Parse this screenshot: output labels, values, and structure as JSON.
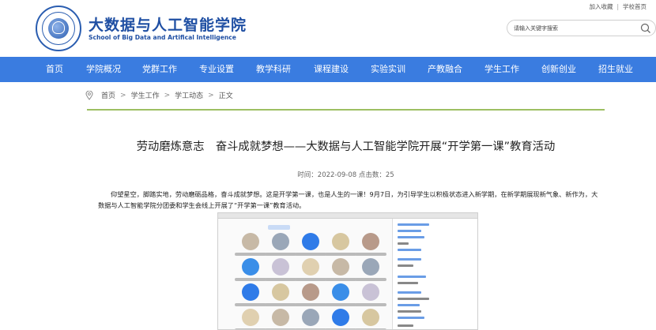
{
  "header": {
    "links": [
      "加入收藏",
      "学校首页"
    ],
    "logo_cn": "大数据与人工智能学院",
    "logo_en": "School of Big Data and Artifical Intelligence",
    "search_placeholder": "请输入关键字搜索"
  },
  "nav": {
    "items": [
      "首页",
      "学院概况",
      "党群工作",
      "专业设置",
      "教学科研",
      "课程建设",
      "实验实训",
      "产教融合",
      "学生工作",
      "创新创业",
      "招生就业"
    ]
  },
  "breadcrumb": [
    "首页",
    "学生工作",
    "学工动态",
    "正文"
  ],
  "article": {
    "title": "劳动磨炼意志　奋斗成就梦想——大数据与人工智能学院开展“开学第一课”教育活动",
    "meta": "时间：2022-09-08 点击数：25",
    "paragraph": "仰望星空，脚踏实地，劳动磨砺品格，奋斗成就梦想。这是开学第一课，也是人生的一课！9月7日，为引导学生以积极状态进入新学期，在新学期展现新气象、新作为，大数据与人工智能学院分团委和学生会线上开展了“开学第一课”教育活动。"
  },
  "colors": {
    "nav_bg": "#3a7ce0",
    "brand_blue": "#1f4fa3",
    "accent_line": "#9dbf62"
  },
  "icons": [
    "logo-emblem",
    "search-icon",
    "location-pin-icon",
    "breadcrumb-arrow-icon"
  ]
}
